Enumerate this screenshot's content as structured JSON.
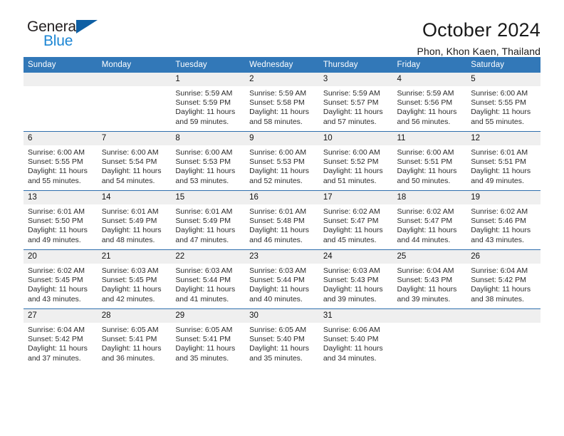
{
  "brand": {
    "name_part1": "General",
    "name_part2": "Blue",
    "triangle_color": "#0e5fa4",
    "blue_text_color": "#1c86d4"
  },
  "header": {
    "title": "October 2024",
    "subtitle": "Phon, Khon Kaen, Thailand",
    "header_bg_color": "#3278b8",
    "daynum_bg_color": "#efefef"
  },
  "weekday_headers": [
    "Sunday",
    "Monday",
    "Tuesday",
    "Wednesday",
    "Thursday",
    "Friday",
    "Saturday"
  ],
  "weeks": [
    [
      {
        "day": "",
        "sunrise": "",
        "sunset": "",
        "daylight": ""
      },
      {
        "day": "",
        "sunrise": "",
        "sunset": "",
        "daylight": ""
      },
      {
        "day": "1",
        "sunrise": "Sunrise: 5:59 AM",
        "sunset": "Sunset: 5:59 PM",
        "daylight": "Daylight: 11 hours and 59 minutes."
      },
      {
        "day": "2",
        "sunrise": "Sunrise: 5:59 AM",
        "sunset": "Sunset: 5:58 PM",
        "daylight": "Daylight: 11 hours and 58 minutes."
      },
      {
        "day": "3",
        "sunrise": "Sunrise: 5:59 AM",
        "sunset": "Sunset: 5:57 PM",
        "daylight": "Daylight: 11 hours and 57 minutes."
      },
      {
        "day": "4",
        "sunrise": "Sunrise: 5:59 AM",
        "sunset": "Sunset: 5:56 PM",
        "daylight": "Daylight: 11 hours and 56 minutes."
      },
      {
        "day": "5",
        "sunrise": "Sunrise: 6:00 AM",
        "sunset": "Sunset: 5:55 PM",
        "daylight": "Daylight: 11 hours and 55 minutes."
      }
    ],
    [
      {
        "day": "6",
        "sunrise": "Sunrise: 6:00 AM",
        "sunset": "Sunset: 5:55 PM",
        "daylight": "Daylight: 11 hours and 55 minutes."
      },
      {
        "day": "7",
        "sunrise": "Sunrise: 6:00 AM",
        "sunset": "Sunset: 5:54 PM",
        "daylight": "Daylight: 11 hours and 54 minutes."
      },
      {
        "day": "8",
        "sunrise": "Sunrise: 6:00 AM",
        "sunset": "Sunset: 5:53 PM",
        "daylight": "Daylight: 11 hours and 53 minutes."
      },
      {
        "day": "9",
        "sunrise": "Sunrise: 6:00 AM",
        "sunset": "Sunset: 5:53 PM",
        "daylight": "Daylight: 11 hours and 52 minutes."
      },
      {
        "day": "10",
        "sunrise": "Sunrise: 6:00 AM",
        "sunset": "Sunset: 5:52 PM",
        "daylight": "Daylight: 11 hours and 51 minutes."
      },
      {
        "day": "11",
        "sunrise": "Sunrise: 6:00 AM",
        "sunset": "Sunset: 5:51 PM",
        "daylight": "Daylight: 11 hours and 50 minutes."
      },
      {
        "day": "12",
        "sunrise": "Sunrise: 6:01 AM",
        "sunset": "Sunset: 5:51 PM",
        "daylight": "Daylight: 11 hours and 49 minutes."
      }
    ],
    [
      {
        "day": "13",
        "sunrise": "Sunrise: 6:01 AM",
        "sunset": "Sunset: 5:50 PM",
        "daylight": "Daylight: 11 hours and 49 minutes."
      },
      {
        "day": "14",
        "sunrise": "Sunrise: 6:01 AM",
        "sunset": "Sunset: 5:49 PM",
        "daylight": "Daylight: 11 hours and 48 minutes."
      },
      {
        "day": "15",
        "sunrise": "Sunrise: 6:01 AM",
        "sunset": "Sunset: 5:49 PM",
        "daylight": "Daylight: 11 hours and 47 minutes."
      },
      {
        "day": "16",
        "sunrise": "Sunrise: 6:01 AM",
        "sunset": "Sunset: 5:48 PM",
        "daylight": "Daylight: 11 hours and 46 minutes."
      },
      {
        "day": "17",
        "sunrise": "Sunrise: 6:02 AM",
        "sunset": "Sunset: 5:47 PM",
        "daylight": "Daylight: 11 hours and 45 minutes."
      },
      {
        "day": "18",
        "sunrise": "Sunrise: 6:02 AM",
        "sunset": "Sunset: 5:47 PM",
        "daylight": "Daylight: 11 hours and 44 minutes."
      },
      {
        "day": "19",
        "sunrise": "Sunrise: 6:02 AM",
        "sunset": "Sunset: 5:46 PM",
        "daylight": "Daylight: 11 hours and 43 minutes."
      }
    ],
    [
      {
        "day": "20",
        "sunrise": "Sunrise: 6:02 AM",
        "sunset": "Sunset: 5:45 PM",
        "daylight": "Daylight: 11 hours and 43 minutes."
      },
      {
        "day": "21",
        "sunrise": "Sunrise: 6:03 AM",
        "sunset": "Sunset: 5:45 PM",
        "daylight": "Daylight: 11 hours and 42 minutes."
      },
      {
        "day": "22",
        "sunrise": "Sunrise: 6:03 AM",
        "sunset": "Sunset: 5:44 PM",
        "daylight": "Daylight: 11 hours and 41 minutes."
      },
      {
        "day": "23",
        "sunrise": "Sunrise: 6:03 AM",
        "sunset": "Sunset: 5:44 PM",
        "daylight": "Daylight: 11 hours and 40 minutes."
      },
      {
        "day": "24",
        "sunrise": "Sunrise: 6:03 AM",
        "sunset": "Sunset: 5:43 PM",
        "daylight": "Daylight: 11 hours and 39 minutes."
      },
      {
        "day": "25",
        "sunrise": "Sunrise: 6:04 AM",
        "sunset": "Sunset: 5:43 PM",
        "daylight": "Daylight: 11 hours and 39 minutes."
      },
      {
        "day": "26",
        "sunrise": "Sunrise: 6:04 AM",
        "sunset": "Sunset: 5:42 PM",
        "daylight": "Daylight: 11 hours and 38 minutes."
      }
    ],
    [
      {
        "day": "27",
        "sunrise": "Sunrise: 6:04 AM",
        "sunset": "Sunset: 5:42 PM",
        "daylight": "Daylight: 11 hours and 37 minutes."
      },
      {
        "day": "28",
        "sunrise": "Sunrise: 6:05 AM",
        "sunset": "Sunset: 5:41 PM",
        "daylight": "Daylight: 11 hours and 36 minutes."
      },
      {
        "day": "29",
        "sunrise": "Sunrise: 6:05 AM",
        "sunset": "Sunset: 5:41 PM",
        "daylight": "Daylight: 11 hours and 35 minutes."
      },
      {
        "day": "30",
        "sunrise": "Sunrise: 6:05 AM",
        "sunset": "Sunset: 5:40 PM",
        "daylight": "Daylight: 11 hours and 35 minutes."
      },
      {
        "day": "31",
        "sunrise": "Sunrise: 6:06 AM",
        "sunset": "Sunset: 5:40 PM",
        "daylight": "Daylight: 11 hours and 34 minutes."
      },
      {
        "day": "",
        "sunrise": "",
        "sunset": "",
        "daylight": ""
      },
      {
        "day": "",
        "sunrise": "",
        "sunset": "",
        "daylight": ""
      }
    ]
  ]
}
